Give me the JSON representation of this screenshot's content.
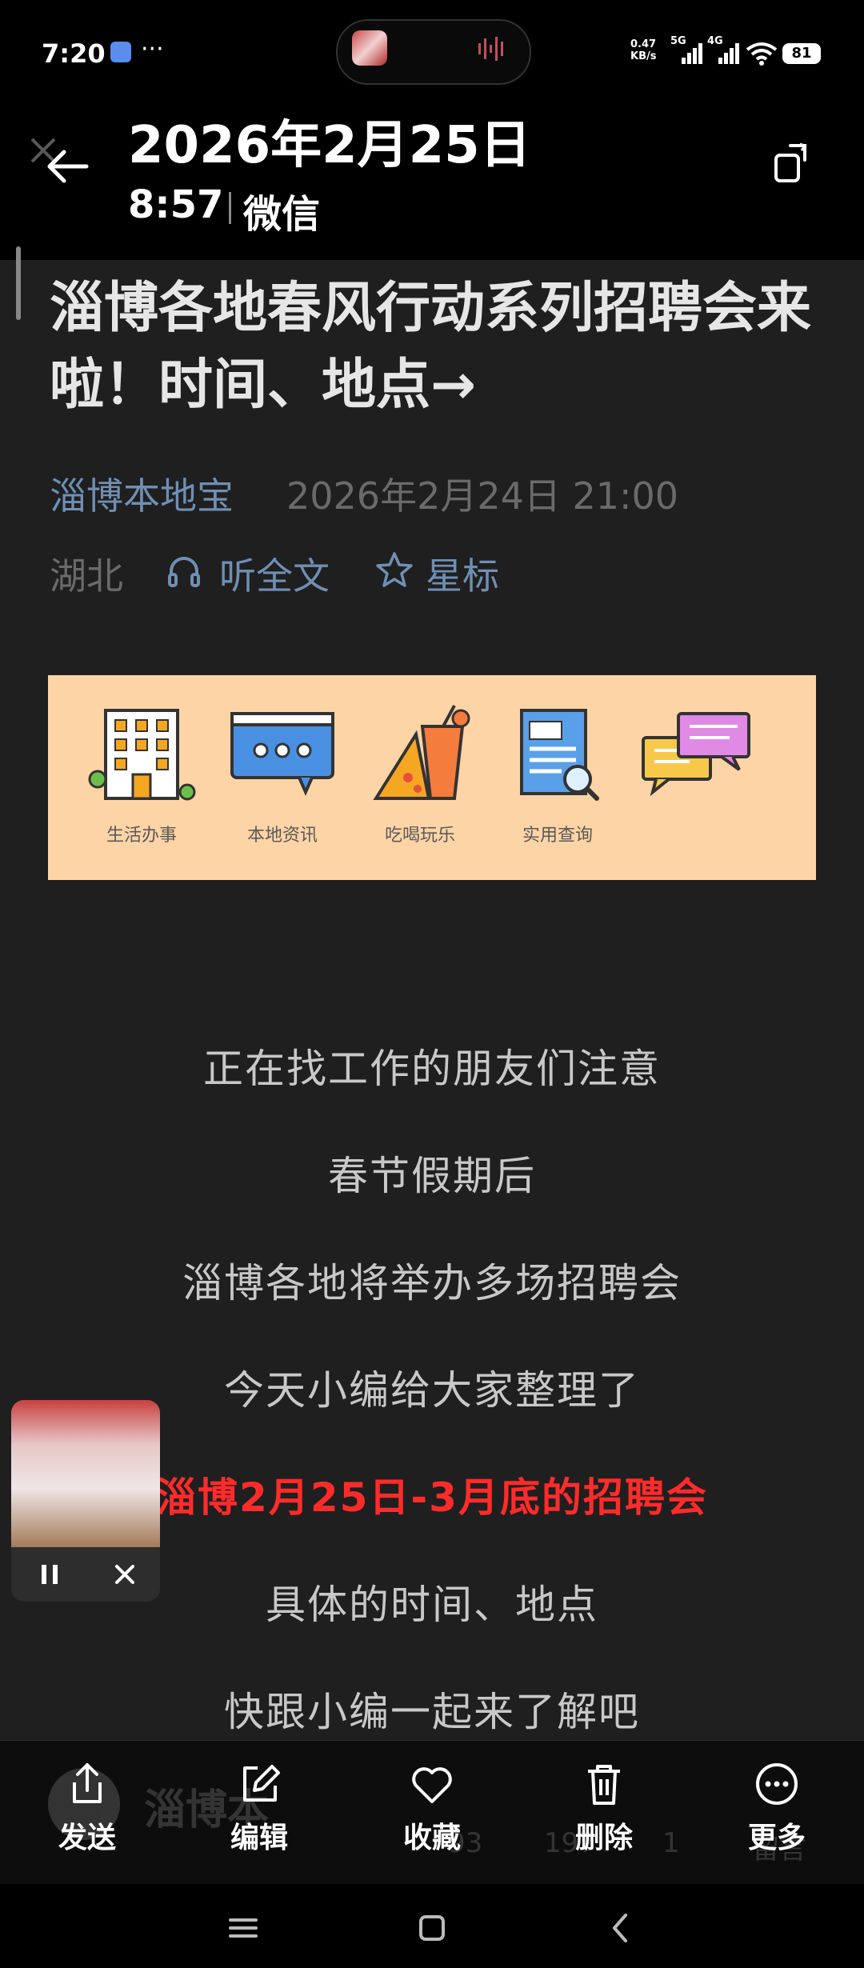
{
  "status_bar": {
    "time": "7:20",
    "dots": "···",
    "net_speed_value": "0.47",
    "net_speed_unit": "KB/s",
    "sig1_label": "5G",
    "sig2_label": "4G",
    "battery": "81"
  },
  "header": {
    "date_title": "2026年2月25日",
    "time": "8:57",
    "app_name": "微信"
  },
  "article": {
    "title": "淄博各地春风行动系列招聘会来啦！时间、地点→",
    "account_name": "淄博本地宝",
    "publish_date": "2026年2月24日 21:00",
    "location": "湖北",
    "listen_label": "听全文",
    "star_label": "星标"
  },
  "banner": {
    "items": [
      {
        "label": "生活办事",
        "icon": "building-icon"
      },
      {
        "label": "本地资讯",
        "icon": "chat-bubble-icon"
      },
      {
        "label": "吃喝玩乐",
        "icon": "drink-pizza-icon"
      },
      {
        "label": "实用查询",
        "icon": "document-search-icon"
      },
      {
        "label": "",
        "icon": "messages-icon"
      }
    ]
  },
  "paragraphs": [
    {
      "text": "正在找工作的朋友们注意",
      "highlight": false
    },
    {
      "text": "春节假期后",
      "highlight": false
    },
    {
      "text": "淄博各地将举办多场招聘会",
      "highlight": false
    },
    {
      "text": "今天小编给大家整理了",
      "highlight": false
    },
    {
      "text": "淄博2月25日-3月底的招聘会",
      "highlight": true
    },
    {
      "text": "具体的时间、地点",
      "highlight": false
    },
    {
      "text": "快跟小编一起来了解吧",
      "highlight": false
    }
  ],
  "ghost_row": {
    "account": "淄博本",
    "count1": "93",
    "count2": "197",
    "count3": "1",
    "comment": "留言"
  },
  "toolbar": {
    "buttons": [
      {
        "label": "发送",
        "icon": "share-icon"
      },
      {
        "label": "编辑",
        "icon": "edit-icon"
      },
      {
        "label": "收藏",
        "icon": "heart-icon"
      },
      {
        "label": "删除",
        "icon": "trash-icon"
      },
      {
        "label": "更多",
        "icon": "more-icon"
      }
    ]
  },
  "colors": {
    "highlight_red": "#ff2b2b",
    "link_blue": "#6f8fb4",
    "banner_bg": "#fdd4a6",
    "article_bg": "#1f1f1f"
  }
}
